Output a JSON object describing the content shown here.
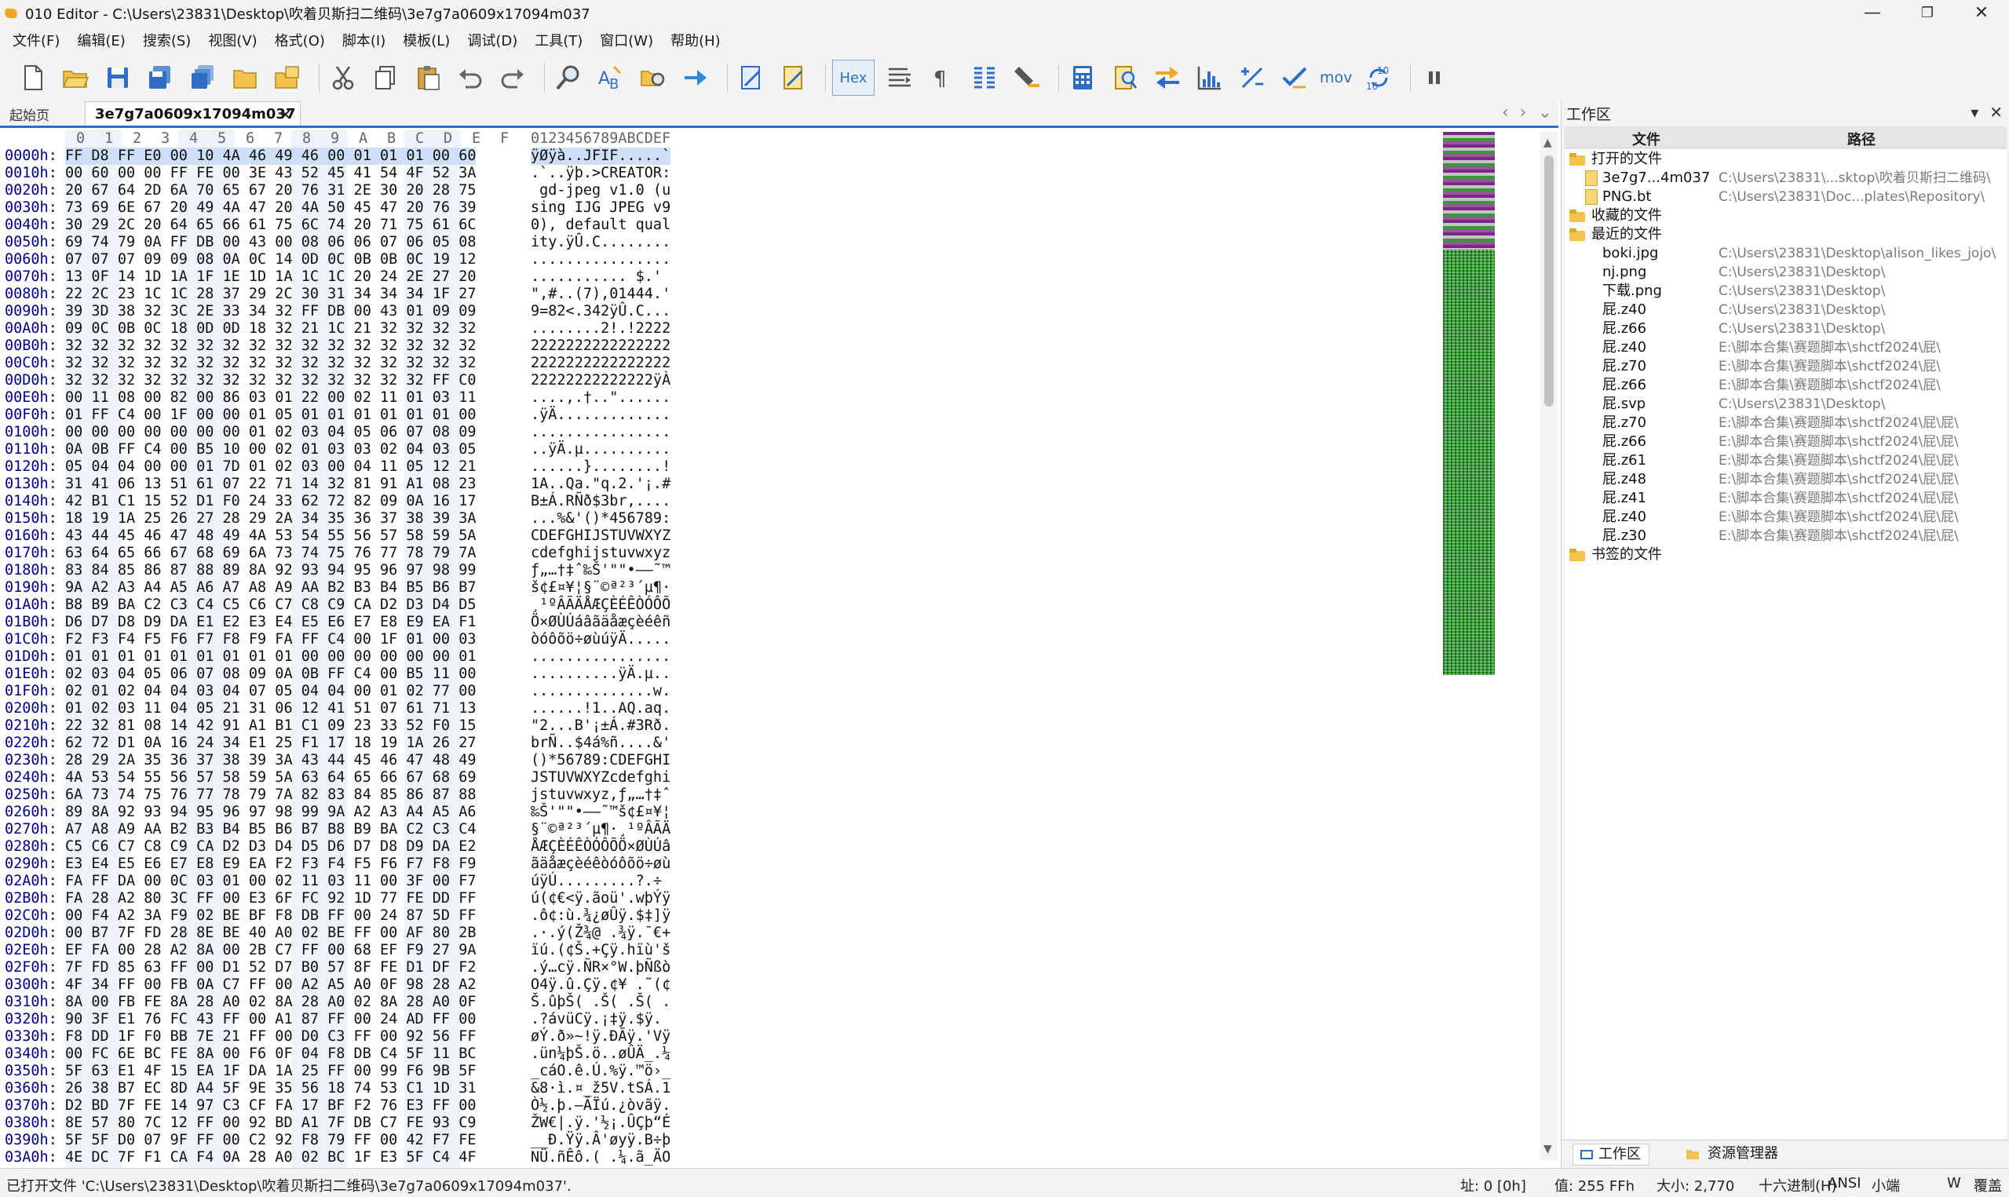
{
  "window": {
    "title": "010 Editor - C:\\Users\\23831\\Desktop\\吹着贝斯扫二维码\\3e7g7a0609x17094m037",
    "minimize": "—",
    "restore": "❐",
    "close": "✕"
  },
  "menu": [
    "文件(F)",
    "编辑(E)",
    "搜索(S)",
    "视图(V)",
    "格式(O)",
    "脚本(I)",
    "模板(L)",
    "调试(D)",
    "工具(T)",
    "窗口(W)",
    "帮助(H)"
  ],
  "toolbar": {
    "icons": [
      "new-file-icon",
      "open-file-icon",
      "save-icon",
      "save-as-icon",
      "save-all-icon",
      "open-folder-icon",
      "open-project-icon",
      "cut-icon",
      "copy-icon",
      "paste-icon",
      "undo-icon",
      "redo-icon",
      "find-icon",
      "replace-icon",
      "find-in-files-icon",
      "goto-icon",
      "run-script-icon",
      "run-template-icon"
    ],
    "hex_label": "Hex",
    "mov_label": "mov",
    "more_icons": [
      "text-format-icon",
      "pilcrow-icon",
      "columns-icon",
      "highlight-icon",
      "calculator-icon",
      "inspector-icon",
      "compare-icon",
      "histogram-icon",
      "percent-icon",
      "checksum-icon",
      "base-converter-icon",
      "pause-icon"
    ]
  },
  "tabs": {
    "start_label": "起始页",
    "file_label": "3e7g7a0609x17094m037",
    "close_glyph": "✕",
    "nav": [
      "‹",
      "›",
      "⌄"
    ]
  },
  "editor": {
    "header_cols": [
      "0",
      "1",
      "2",
      "3",
      "4",
      "5",
      "6",
      "7",
      "8",
      "9",
      "A",
      "B",
      "C",
      "D",
      "E",
      "F"
    ],
    "ascii_header": "0123456789ABCDEF",
    "rows": [
      {
        "addr": "0000h:",
        "hex": "FF D8 FF E0 00 10 4A 46 49 46 00 01 01 01 00 60",
        "ascii": "ÿØÿà..JFIF.....`"
      },
      {
        "addr": "0010h:",
        "hex": "00 60 00 00 FF FE 00 3E 43 52 45 41 54 4F 52 3A",
        "ascii": ".`..ÿþ.>CREATOR:"
      },
      {
        "addr": "0020h:",
        "hex": "20 67 64 2D 6A 70 65 67 20 76 31 2E 30 20 28 75",
        "ascii": " gd-jpeg v1.0 (u"
      },
      {
        "addr": "0030h:",
        "hex": "73 69 6E 67 20 49 4A 47 20 4A 50 45 47 20 76 39",
        "ascii": "sing IJG JPEG v9"
      },
      {
        "addr": "0040h:",
        "hex": "30 29 2C 20 64 65 66 61 75 6C 74 20 71 75 61 6C",
        "ascii": "0), default qual"
      },
      {
        "addr": "0050h:",
        "hex": "69 74 79 0A FF DB 00 43 00 08 06 06 07 06 05 08",
        "ascii": "ity.ÿÛ.C........"
      },
      {
        "addr": "0060h:",
        "hex": "07 07 07 09 09 08 0A 0C 14 0D 0C 0B 0B 0C 19 12",
        "ascii": "................"
      },
      {
        "addr": "0070h:",
        "hex": "13 0F 14 1D 1A 1F 1E 1D 1A 1C 1C 20 24 2E 27 20",
        "ascii": "........... $.' "
      },
      {
        "addr": "0080h:",
        "hex": "22 2C 23 1C 1C 28 37 29 2C 30 31 34 34 34 1F 27",
        "ascii": "\",#..(7),01444.'"
      },
      {
        "addr": "0090h:",
        "hex": "39 3D 38 32 3C 2E 33 34 32 FF DB 00 43 01 09 09",
        "ascii": "9=82<.342ÿÛ.C..."
      },
      {
        "addr": "00A0h:",
        "hex": "09 0C 0B 0C 18 0D 0D 18 32 21 1C 21 32 32 32 32",
        "ascii": "........2!.!2222"
      },
      {
        "addr": "00B0h:",
        "hex": "32 32 32 32 32 32 32 32 32 32 32 32 32 32 32 32",
        "ascii": "2222222222222222"
      },
      {
        "addr": "00C0h:",
        "hex": "32 32 32 32 32 32 32 32 32 32 32 32 32 32 32 32",
        "ascii": "2222222222222222"
      },
      {
        "addr": "00D0h:",
        "hex": "32 32 32 32 32 32 32 32 32 32 32 32 32 32 FF C0",
        "ascii": "22222222222222ÿÀ"
      },
      {
        "addr": "00E0h:",
        "hex": "00 11 08 00 82 00 86 03 01 22 00 02 11 01 03 11",
        "ascii": "....‚.†..\"......"
      },
      {
        "addr": "00F0h:",
        "hex": "01 FF C4 00 1F 00 00 01 05 01 01 01 01 01 01 00",
        "ascii": ".ÿÄ............."
      },
      {
        "addr": "0100h:",
        "hex": "00 00 00 00 00 00 00 01 02 03 04 05 06 07 08 09",
        "ascii": "................"
      },
      {
        "addr": "0110h:",
        "hex": "0A 0B FF C4 00 B5 10 00 02 01 03 03 02 04 03 05",
        "ascii": "..ÿÄ.µ.........."
      },
      {
        "addr": "0120h:",
        "hex": "05 04 04 00 00 01 7D 01 02 03 00 04 11 05 12 21",
        "ascii": "......}........!"
      },
      {
        "addr": "0130h:",
        "hex": "31 41 06 13 51 61 07 22 71 14 32 81 91 A1 08 23",
        "ascii": "1A..Qa.\"q.2.'¡.#"
      },
      {
        "addr": "0140h:",
        "hex": "42 B1 C1 15 52 D1 F0 24 33 62 72 82 09 0A 16 17",
        "ascii": "B±Á.RÑð$3br‚...."
      },
      {
        "addr": "0150h:",
        "hex": "18 19 1A 25 26 27 28 29 2A 34 35 36 37 38 39 3A",
        "ascii": "...%&'()*456789:"
      },
      {
        "addr": "0160h:",
        "hex": "43 44 45 46 47 48 49 4A 53 54 55 56 57 58 59 5A",
        "ascii": "CDEFGHIJSTUVWXYZ"
      },
      {
        "addr": "0170h:",
        "hex": "63 64 65 66 67 68 69 6A 73 74 75 76 77 78 79 7A",
        "ascii": "cdefghijstuvwxyz"
      },
      {
        "addr": "0180h:",
        "hex": "83 84 85 86 87 88 89 8A 92 93 94 95 96 97 98 99",
        "ascii": "ƒ„…†‡ˆ‰Š'\"\"•–—˜™"
      },
      {
        "addr": "0190h:",
        "hex": "9A A2 A3 A4 A5 A6 A7 A8 A9 AA B2 B3 B4 B5 B6 B7",
        "ascii": "š¢£¤¥¦§¨©ª²³´µ¶·"
      },
      {
        "addr": "01A0h:",
        "hex": "B8 B9 BA C2 C3 C4 C5 C6 C7 C8 C9 CA D2 D3 D4 D5",
        "ascii": "¸¹ºÂÃÄÅÆÇÈÉÊÒÓÔÕ"
      },
      {
        "addr": "01B0h:",
        "hex": "D6 D7 D8 D9 DA E1 E2 E3 E4 E5 E6 E7 E8 E9 EA F1",
        "ascii": "Ö×ØÙÚáâãäåæçèéêñ"
      },
      {
        "addr": "01C0h:",
        "hex": "F2 F3 F4 F5 F6 F7 F8 F9 FA FF C4 00 1F 01 00 03",
        "ascii": "òóôõö÷øùúÿÄ....."
      },
      {
        "addr": "01D0h:",
        "hex": "01 01 01 01 01 01 01 01 01 00 00 00 00 00 00 01",
        "ascii": "................"
      },
      {
        "addr": "01E0h:",
        "hex": "02 03 04 05 06 07 08 09 0A 0B FF C4 00 B5 11 00",
        "ascii": "..........ÿÄ.µ.."
      },
      {
        "addr": "01F0h:",
        "hex": "02 01 02 04 04 03 04 07 05 04 04 00 01 02 77 00",
        "ascii": "..............w."
      },
      {
        "addr": "0200h:",
        "hex": "01 02 03 11 04 05 21 31 06 12 41 51 07 61 71 13",
        "ascii": "......!1..AQ.aq."
      },
      {
        "addr": "0210h:",
        "hex": "22 32 81 08 14 42 91 A1 B1 C1 09 23 33 52 F0 15",
        "ascii": "\"2...B'¡±Á.#3Rð."
      },
      {
        "addr": "0220h:",
        "hex": "62 72 D1 0A 16 24 34 E1 25 F1 17 18 19 1A 26 27",
        "ascii": "brÑ..$4á%ñ....&'"
      },
      {
        "addr": "0230h:",
        "hex": "28 29 2A 35 36 37 38 39 3A 43 44 45 46 47 48 49",
        "ascii": "()*56789:CDEFGHI"
      },
      {
        "addr": "0240h:",
        "hex": "4A 53 54 55 56 57 58 59 5A 63 64 65 66 67 68 69",
        "ascii": "JSTUVWXYZcdefghi"
      },
      {
        "addr": "0250h:",
        "hex": "6A 73 74 75 76 77 78 79 7A 82 83 84 85 86 87 88",
        "ascii": "jstuvwxyz‚ƒ„…†‡ˆ"
      },
      {
        "addr": "0260h:",
        "hex": "89 8A 92 93 94 95 96 97 98 99 9A A2 A3 A4 A5 A6",
        "ascii": "‰Š'\"\"•–—˜™š¢£¤¥¦"
      },
      {
        "addr": "0270h:",
        "hex": "A7 A8 A9 AA B2 B3 B4 B5 B6 B7 B8 B9 BA C2 C3 C4",
        "ascii": "§¨©ª²³´µ¶·¸¹ºÂÃÄ"
      },
      {
        "addr": "0280h:",
        "hex": "C5 C6 C7 C8 C9 CA D2 D3 D4 D5 D6 D7 D8 D9 DA E2",
        "ascii": "ÅÆÇÈÉÊÒÓÔÕÖ×ØÙÚâ"
      },
      {
        "addr": "0290h:",
        "hex": "E3 E4 E5 E6 E7 E8 E9 EA F2 F3 F4 F5 F6 F7 F8 F9",
        "ascii": "ãäåæçèéêòóôõö÷øù"
      },
      {
        "addr": "02A0h:",
        "hex": "FA FF DA 00 0C 03 01 00 02 11 03 11 00 3F 00 F7",
        "ascii": "úÿÚ.........?.÷"
      },
      {
        "addr": "02B0h:",
        "hex": "FA 28 A2 80 3C FF 00 E3 6F FC 92 1D 77 FE DD FF",
        "ascii": "ú(¢€<ÿ.ãoü'.wþÝÿ"
      },
      {
        "addr": "02C0h:",
        "hex": "00 F4 A2 3A F9 02 BE BF F8 DB FF 00 24 87 5D FF",
        "ascii": ".ô¢:ù.¾¿øÛÿ.$‡]ÿ"
      },
      {
        "addr": "02D0h:",
        "hex": "00 B7 7F FD 28 8E BE 40 A0 02 BE FF 00 AF 80 2B",
        "ascii": ".·.ý(Ž¾@ .¾ÿ.¯€+"
      },
      {
        "addr": "02E0h:",
        "hex": "EF FA 00 28 A2 8A 00 2B C7 FF 00 68 EF F9 27 9A",
        "ascii": "ïú.(¢Š.+Çÿ.hïù'š"
      },
      {
        "addr": "02F0h:",
        "hex": "7F FD 85 63 FF 00 D1 52 D7 B0 57 8F FE D1 DF F2",
        "ascii": ".ý…cÿ.ÑR×°W.þÑßò"
      },
      {
        "addr": "0300h:",
        "hex": "4F 34 FF 00 FB 0A C7 FF 00 A2 A5 A0 0F 98 28 A2",
        "ascii": "O4ÿ.û.Çÿ.¢¥ .˜(¢"
      },
      {
        "addr": "0310h:",
        "hex": "8A 00 FB FE 8A 28 A0 02 8A 28 A0 02 8A 28 A0 0F",
        "ascii": "Š.ûþŠ( .Š( .Š( ."
      },
      {
        "addr": "0320h:",
        "hex": "90 3F E1 76 FC 43 FF 00 A1 87 FF 00 24 AD FF 00",
        "ascii": ".?ávüCÿ.¡‡ÿ.$­ÿ."
      },
      {
        "addr": "0330h:",
        "hex": "F8 DD 1F F0 BB 7E 21 FF 00 D0 C3 FF 00 92 56 FF",
        "ascii": "øÝ.ð»~!ÿ.ÐÃÿ.'Vÿ"
      },
      {
        "addr": "0340h:",
        "hex": "00 FC 6E BC FE 8A 00 F6 0F 04 F8 DB C4 5F 11 BC",
        "ascii": ".ün¼þŠ.ö..øÛÄ_.¼"
      },
      {
        "addr": "0350h:",
        "hex": "5F 63 E1 4F 15 EA 1F DA 1A 25 FF 00 99 F6 9B 5F",
        "ascii": "_cáO.ê.Ú.%ÿ.™ö›_"
      },
      {
        "addr": "0360h:",
        "hex": "26 38 B7 EC 8D A4 5F 9E 35 56 18 74 53 C1 1D 31",
        "ascii": "&8·ì.¤_ž5V.tSÁ.1"
      },
      {
        "addr": "0370h:",
        "hex": "D2 BD 7F FE 14 97 C3 CF FA 17 BF F2 76 E3 FF 00",
        "ascii": "Ò½.þ.—ÃÏú.¿òvãÿ."
      },
      {
        "addr": "0380h:",
        "hex": "8E 57 80 7C 12 FF 00 92 BD A1 7F DB C7 FE 93 C9",
        "ascii": "ŽW€|.ÿ.'½¡.ÛÇþ“É"
      },
      {
        "addr": "0390h:",
        "hex": "5F 5F D0 07 9F FF 00 C2 92 F8 79 FF 00 42 F7 FE",
        "ascii": "__Ð.Ÿÿ.Â'øyÿ.B÷þ"
      },
      {
        "addr": "03A0h:",
        "hex": "4E DC 7F F1 CA F4 0A 28 A0 02 BC 1F E3 5F C4 4F",
        "ascii": "NÜ.ñÊô.( .¼.ã_ÄO"
      }
    ]
  },
  "workspace": {
    "title": "工作区",
    "ctrl_dropdown": "▾",
    "ctrl_close": "✕",
    "col_file": "文件",
    "col_path": "路径",
    "groups": [
      {
        "label": "打开的文件",
        "items": [
          {
            "name": "3e7g7...4m037",
            "path": "C:\\Users\\23831\\...sktop\\吹着贝斯扫二维码\\",
            "icon": "file"
          },
          {
            "name": "PNG.bt",
            "path": "C:\\Users\\23831\\Doc...plates\\Repository\\",
            "icon": "file"
          }
        ]
      },
      {
        "label": "收藏的文件",
        "items": []
      },
      {
        "label": "最近的文件",
        "items": [
          {
            "name": "boki.jpg",
            "path": "C:\\Users\\23831\\Desktop\\alison_likes_jojo\\"
          },
          {
            "name": "nj.png",
            "path": "C:\\Users\\23831\\Desktop\\"
          },
          {
            "name": "下载.png",
            "path": "C:\\Users\\23831\\Desktop\\"
          },
          {
            "name": "屁.z40",
            "path": "C:\\Users\\23831\\Desktop\\"
          },
          {
            "name": "屁.z66",
            "path": "C:\\Users\\23831\\Desktop\\"
          },
          {
            "name": "屁.z40",
            "path": "E:\\脚本合集\\赛题脚本\\shctf2024\\屁\\"
          },
          {
            "name": "屁.z70",
            "path": "E:\\脚本合集\\赛题脚本\\shctf2024\\屁\\"
          },
          {
            "name": "屁.z66",
            "path": "E:\\脚本合集\\赛题脚本\\shctf2024\\屁\\"
          },
          {
            "name": "屁.svp",
            "path": "C:\\Users\\23831\\Desktop\\"
          },
          {
            "name": "屁.z70",
            "path": "E:\\脚本合集\\赛题脚本\\shctf2024\\屁\\屁\\"
          },
          {
            "name": "屁.z66",
            "path": "E:\\脚本合集\\赛题脚本\\shctf2024\\屁\\屁\\"
          },
          {
            "name": "屁.z61",
            "path": "E:\\脚本合集\\赛题脚本\\shctf2024\\屁\\屁\\"
          },
          {
            "name": "屁.z48",
            "path": "E:\\脚本合集\\赛题脚本\\shctf2024\\屁\\屁\\"
          },
          {
            "name": "屁.z41",
            "path": "E:\\脚本合集\\赛题脚本\\shctf2024\\屁\\屁\\"
          },
          {
            "name": "屁.z40",
            "path": "E:\\脚本合集\\赛题脚本\\shctf2024\\屁\\屁\\"
          },
          {
            "name": "屁.z30",
            "path": "E:\\脚本合集\\赛题脚本\\shctf2024\\屁\\屁\\"
          }
        ]
      },
      {
        "label": "书签的文件",
        "items": []
      }
    ],
    "tab_workspace": "工作区",
    "tab_explorer": "资源管理器"
  },
  "status": {
    "message": "已打开文件 'C:\\Users\\23831\\Desktop\\吹着贝斯扫二维码\\3e7g7a0609x17094m037'.",
    "position": "址: 0 [0h]",
    "value": "值: 255 FFh",
    "size": "大小: 2,770",
    "mode": "十六进制(H)",
    "encoding": "ANSI",
    "endian": "小端",
    "write": "W",
    "overwrite": "覆盖"
  }
}
